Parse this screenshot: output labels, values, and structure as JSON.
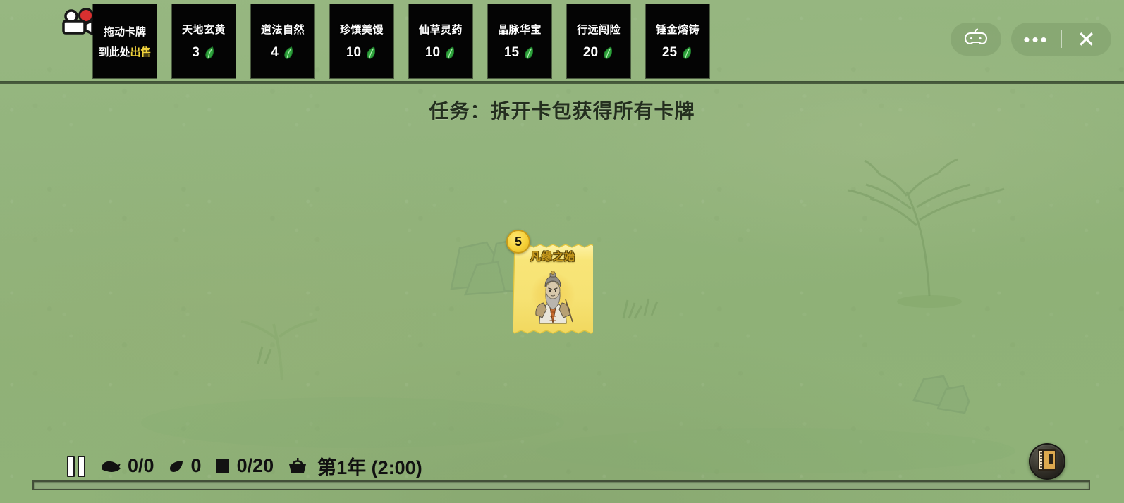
{
  "window": {
    "record_icon": "video-record-icon",
    "gamepad_icon": "gamepad-icon",
    "more_label": "•••",
    "close_label": "✕"
  },
  "shop": {
    "sell_slot": {
      "line1": "拖动卡牌",
      "line2_prefix": "到此处",
      "line2_highlight": "出售"
    },
    "packs": [
      {
        "name": "天地玄黄",
        "price": "3",
        "currency_icon": "leaf-icon"
      },
      {
        "name": "道法自然",
        "price": "4",
        "currency_icon": "leaf-icon"
      },
      {
        "name": "珍馔美馒",
        "price": "10",
        "currency_icon": "leaf-icon"
      },
      {
        "name": "仙草灵药",
        "price": "10",
        "currency_icon": "leaf-icon"
      },
      {
        "name": "晶脉华宝",
        "price": "15",
        "currency_icon": "leaf-icon"
      },
      {
        "name": "行远闯险",
        "price": "20",
        "currency_icon": "leaf-icon"
      },
      {
        "name": "锤金熔铸",
        "price": "25",
        "currency_icon": "leaf-icon"
      }
    ]
  },
  "mission": {
    "text": "任务：拆开卡包获得所有卡牌"
  },
  "board": {
    "card": {
      "title": "凡缘之始",
      "badge": "5",
      "art": "sage-elder-portrait"
    }
  },
  "hud": {
    "pause_icon": "pause-icon",
    "population": "0/0",
    "population_icon": "creature-icon",
    "leaves": "0",
    "leaves_icon": "leaf-icon",
    "storage": "0/20",
    "storage_icon": "crate-icon",
    "time_icon": "basket-icon",
    "time": "第1年  (2:00)",
    "book_icon": "journal-icon",
    "progress_percent": 0
  },
  "colors": {
    "background": "#8fb177",
    "card_black": "#040404",
    "highlight": "#f0d23c",
    "leaf_green": "#2ea33c",
    "card_yellow": "#f5e06a",
    "badge_gold": "#f5cf36"
  }
}
